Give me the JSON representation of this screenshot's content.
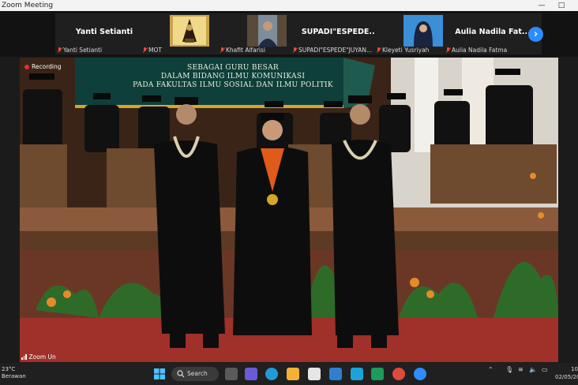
{
  "window": {
    "title": "Zoom Meeting",
    "minimize_glyph": "—",
    "maximize_glyph": "□"
  },
  "participants": [
    {
      "display_name": "Yanti Setianti",
      "label": "Yanti Setianti",
      "muted": true,
      "has_video": false
    },
    {
      "display_name": "",
      "label": "MOT",
      "muted": true,
      "has_video": true
    },
    {
      "display_name": "",
      "label": "Khafit Alfarisi",
      "muted": true,
      "has_video": true
    },
    {
      "display_name": "SUPADI\"ESPEDE...",
      "label": "SUPADI\"ESPEDE\"JUYAN...",
      "muted": true,
      "has_video": false
    },
    {
      "display_name": "",
      "label": "Kleyeti Yusriyah",
      "muted": true,
      "has_video": true
    },
    {
      "display_name": "Aulia Nadila Fat...",
      "label": "Aulia Nadila Fatma",
      "muted": true,
      "has_video": false
    }
  ],
  "next_button": "›",
  "main_video": {
    "recording_label": "Recording",
    "zoom_label": "Zoom Un",
    "banner": [
      "SEBAGAI GURU BESAR",
      "DALAM BIDANG ILMU KOMUNIKASI",
      "PADA FAKULTAS ILMU SOSIAL DAN ILMU POLITIK"
    ]
  },
  "taskbar": {
    "weather_temp": "23°C",
    "weather_desc": "Berawan",
    "search_label": "Search",
    "time": "10",
    "date": "02/05/20",
    "apps": [
      "windows-icon",
      "search-icon",
      "task-view-icon",
      "chat-icon",
      "edge-icon",
      "file-explorer-icon",
      "store-icon",
      "mail-icon",
      "l-app-icon",
      "office-icon",
      "chrome-icon",
      "zoom-icon"
    ],
    "tray_icons": [
      "chevron-up-icon",
      "wifi-icon",
      "volume-icon",
      "battery-icon"
    ],
    "colors": {
      "accent": "#2d8cff",
      "taskbar": "#202020"
    }
  }
}
